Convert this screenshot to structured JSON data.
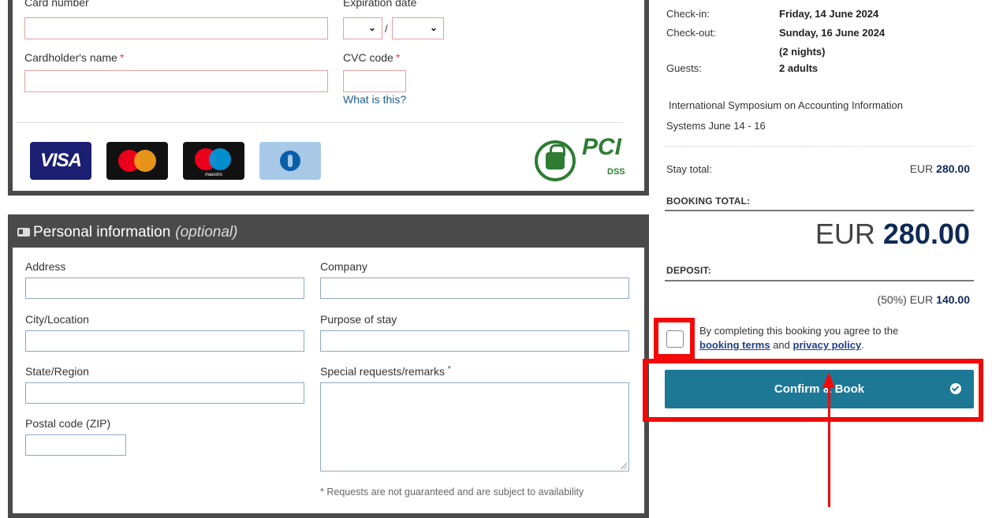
{
  "payment": {
    "card_number_label": "Card number",
    "expiration_label": "Expiration date",
    "expiration_slash": "/",
    "cardholder_label": "Cardholder's name",
    "cvc_label": "CVC code",
    "required_mark": "*",
    "what_is_this": "What is this?",
    "card_logos": [
      "VISA",
      "mastercard",
      "maestro",
      "diners club"
    ],
    "visa_text": "VISA",
    "maestro_text": "maestro",
    "pci_text": "PCI",
    "dss_text": "DSS"
  },
  "personal": {
    "title": "Personal information",
    "optional": "(optional)",
    "address_label": "Address",
    "company_label": "Company",
    "city_label": "City/Location",
    "purpose_label": "Purpose of stay",
    "state_label": "State/Region",
    "special_label": "Special requests/remarks",
    "special_mark": "*",
    "postal_label": "Postal code (ZIP)",
    "note": "* Requests are not guaranteed and are subject to availability"
  },
  "summary": {
    "checkin_label": "Check-in:",
    "checkin_value": "Friday, 14 June 2024",
    "checkout_label": "Check-out:",
    "checkout_value": "Sunday, 16 June 2024",
    "nights": "(2 nights)",
    "guests_label": "Guests:",
    "guests_value": "2 adults",
    "event_line1": "International Symposium on Accounting Information",
    "event_line2": "Systems June 14 - 16",
    "stay_total_label": "Stay total:",
    "stay_total_currency": "EUR",
    "stay_total_amount": "280.00",
    "booking_total_label": "BOOKING TOTAL:",
    "booking_total_currency": "EUR",
    "booking_total_amount": "280.00",
    "deposit_label": "DEPOSIT:",
    "deposit_prefix": "(50%) EUR",
    "deposit_amount": "140.00"
  },
  "terms": {
    "text_before": "By completing this booking you agree to the",
    "booking_terms": "booking terms",
    "and": "and",
    "privacy_policy": "privacy policy",
    "period": "."
  },
  "confirm_button_label": "Confirm & Book",
  "colors": {
    "panel_dark": "#4a4a4a",
    "button": "#1d7896",
    "highlight": "#f20a0a",
    "total_blue": "#0f2a55",
    "link": "#1f5e8c"
  }
}
